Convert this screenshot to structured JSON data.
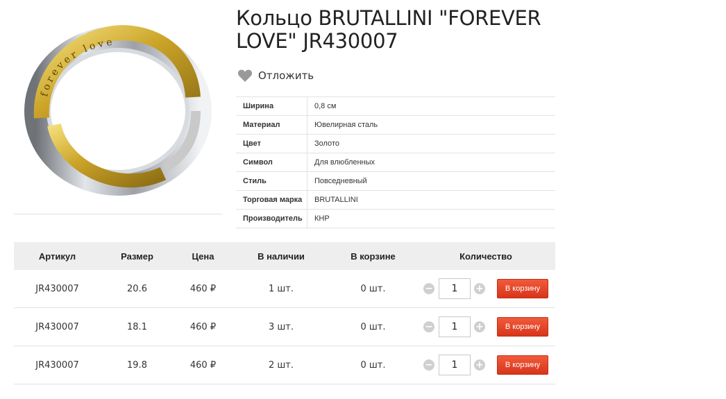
{
  "product": {
    "title": "Кольцо BRUTALLINI \"FOREVER LOVE\" JR430007",
    "engraving": "forever love",
    "wishlist_label": "Отложить",
    "properties": [
      {
        "name": "Ширина",
        "value": "0,8 см"
      },
      {
        "name": "Материал",
        "value": "Ювелирная сталь"
      },
      {
        "name": "Цвет",
        "value": "Золото"
      },
      {
        "name": "Символ",
        "value": "Для влюбленных"
      },
      {
        "name": "Стиль",
        "value": "Повседневный"
      },
      {
        "name": "Торговая марка",
        "value": "BRUTALLINI"
      },
      {
        "name": "Производитель",
        "value": "КНР"
      }
    ]
  },
  "offers": {
    "headers": {
      "article": "Артикул",
      "size": "Размер",
      "price": "Цена",
      "stock": "В наличии",
      "in_cart": "В корзине",
      "qty": "Количество"
    },
    "rows": [
      {
        "article": "JR430007",
        "size": "20.6",
        "price": "460 ₽",
        "stock": "1 шт.",
        "in_cart": "0 шт.",
        "qty": "1",
        "button": "В корзину"
      },
      {
        "article": "JR430007",
        "size": "18.1",
        "price": "460 ₽",
        "stock": "3 шт.",
        "in_cart": "0 шт.",
        "qty": "1",
        "button": "В корзину"
      },
      {
        "article": "JR430007",
        "size": "19.8",
        "price": "460 ₽",
        "stock": "2 шт.",
        "in_cart": "0 шт.",
        "qty": "1",
        "button": "В корзину"
      }
    ],
    "minus_symbol": "−",
    "plus_symbol": "+"
  },
  "colors": {
    "accent": "#e8432a",
    "gold": "#c9a227",
    "silver": "#b8bcc2",
    "icon_gray": "#999999"
  }
}
